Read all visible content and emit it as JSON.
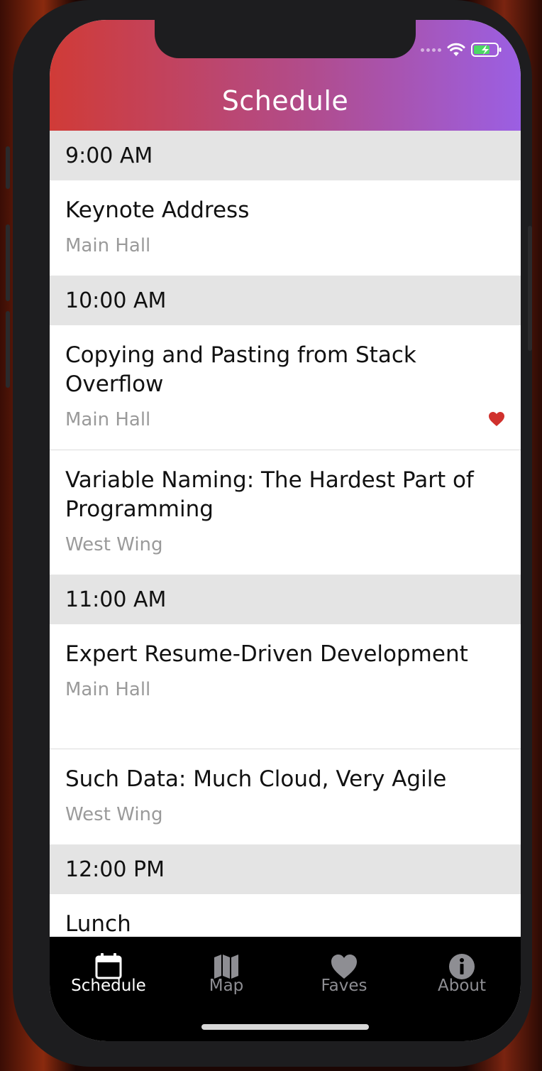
{
  "header": {
    "title": "Schedule"
  },
  "sections": [
    {
      "time": "9:00 AM",
      "sessions": [
        {
          "title": "Keynote Address",
          "room": "Main Hall",
          "favorite": false
        }
      ]
    },
    {
      "time": "10:00 AM",
      "sessions": [
        {
          "title": "Copying and Pasting from Stack Overflow",
          "room": "Main Hall",
          "favorite": true
        },
        {
          "title": "Variable Naming: The Hardest Part of Programming",
          "room": "West Wing",
          "favorite": false
        }
      ]
    },
    {
      "time": "11:00 AM",
      "sessions": [
        {
          "title": "Expert Resume-Driven Development",
          "room": "Main Hall",
          "favorite": false
        },
        {
          "title": "Such Data: Much Cloud, Very Agile",
          "room": "West Wing",
          "favorite": false
        }
      ]
    },
    {
      "time": "12:00 PM",
      "sessions": [
        {
          "title": "Lunch",
          "room": "",
          "favorite": false
        }
      ]
    }
  ],
  "tabs": [
    {
      "label": "Schedule",
      "icon": "calendar-icon",
      "active": true
    },
    {
      "label": "Map",
      "icon": "map-icon",
      "active": false
    },
    {
      "label": "Faves",
      "icon": "heart-icon",
      "active": false
    },
    {
      "label": "About",
      "icon": "info-icon",
      "active": false
    }
  ],
  "colors": {
    "header_gradient_start": "#d03b37",
    "header_gradient_end": "#9b5fe3",
    "favorite": "#d0312d",
    "section_bg": "#e4e4e4",
    "tab_active": "#ffffff",
    "tab_inactive": "#8e8e93"
  }
}
